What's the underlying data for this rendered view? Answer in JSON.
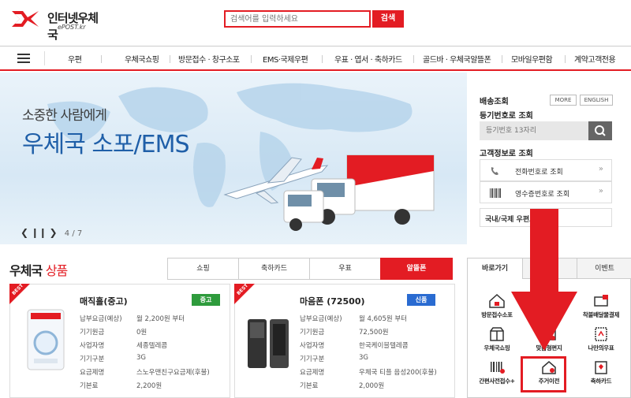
{
  "brand": {
    "name": "인터넷우체국",
    "sub": "ePOST.kr",
    "color": "#e31c23"
  },
  "search": {
    "placeholder": "검색어를 입력하세요",
    "button": "검색"
  },
  "nav": {
    "items": [
      "우편",
      "우체국쇼핑",
      "방문접수 · 창구소포",
      "EMS·국제우편",
      "우표 · 엽서 · 축하카드",
      "골드바 · 우체국알뜰폰",
      "모바일우편함",
      "계약고객전용"
    ]
  },
  "banner": {
    "subtitle": "소중한 사람에게",
    "title": "우체국 소포/EMS",
    "pager": "4 / 7",
    "bg_color": "#dcebf6",
    "title_color": "#1f5fa8"
  },
  "side": {
    "delivery_title": "배송조회",
    "more": "MORE",
    "english": "ENGLISH",
    "registered_title": "등기번호로 조회",
    "registered_placeholder": "등기번호 13자리",
    "customer_title": "고객정보로 조회",
    "phone_lookup": "전화번호로 조회",
    "receipt_lookup": "영수증번호로 조회",
    "domestic_intl": "국내/국제 우편요"
  },
  "products": {
    "title_main": "우체국",
    "title_accent": "상품",
    "tabs": [
      "쇼핑",
      "축하카드",
      "우표",
      "알뜰폰"
    ],
    "active_tab": "알뜰폰",
    "cards": [
      {
        "badge_best": "BEST",
        "name": "매직홀(중고)",
        "tag": "중고",
        "tag_color": "#2e9b3c",
        "specs": [
          {
            "k": "납부요금(예상)",
            "v": "월 2,200원 부터"
          },
          {
            "k": "기기원금",
            "v": "0원"
          },
          {
            "k": "사업자명",
            "v": "세종텔레콤"
          },
          {
            "k": "기기구분",
            "v": "3G"
          },
          {
            "k": "요금제명",
            "v": "스노우맨친구요금제(후불)"
          },
          {
            "k": "기본료",
            "v": "2,200원"
          }
        ]
      },
      {
        "badge_best": "BEST",
        "name": "마음폰 (72500)",
        "tag": "신품",
        "tag_color": "#2a6bd1",
        "specs": [
          {
            "k": "납부요금(예상)",
            "v": "월 4,605원 부터"
          },
          {
            "k": "기기원금",
            "v": "72,500원"
          },
          {
            "k": "사업자명",
            "v": "한국케이블텔레콤"
          },
          {
            "k": "기기구분",
            "v": "3G"
          },
          {
            "k": "요금제명",
            "v": "우체국 티플 음성200(후불)"
          },
          {
            "k": "기본료",
            "v": "2,000원"
          }
        ]
      }
    ]
  },
  "quick": {
    "tabs": [
      "바로가기",
      "",
      "이벤트"
    ],
    "items": [
      {
        "label": "방문접수소포",
        "icon": "house-box-icon"
      },
      {
        "label": "",
        "icon": "hand-icon"
      },
      {
        "label": "착불배달물결제",
        "icon": "pay-icon"
      },
      {
        "label": "우체국쇼핑",
        "icon": "shop-icon"
      },
      {
        "label": "맞춤형편지",
        "icon": "letter-icon"
      },
      {
        "label": "나만의우표",
        "icon": "stamp-icon"
      },
      {
        "label": "간편사전접수+",
        "icon": "barcode-icon"
      },
      {
        "label": "주거이전",
        "icon": "move-house-icon"
      },
      {
        "label": "축하카드",
        "icon": "card-icon"
      }
    ]
  },
  "annotation": {
    "arrow_color": "#e31c23"
  }
}
